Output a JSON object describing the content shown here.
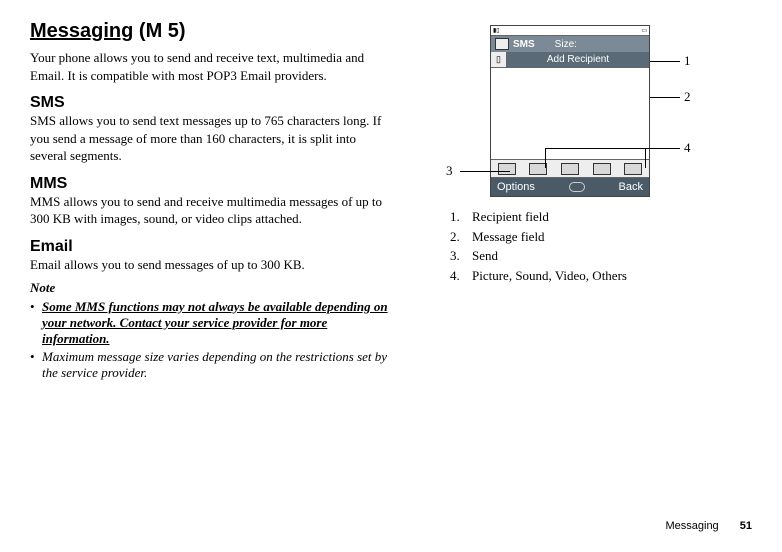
{
  "heading": {
    "title": "Messaging",
    "menu_code": "(M 5)"
  },
  "intro": "Your phone allows you to send and receive text, multimedia and Email. It is compatible with most POP3 Email providers.",
  "sections": {
    "sms": {
      "title": "SMS",
      "body": "SMS allows you to send text messages up to 765 characters long. If you send a message of more than 160 characters, it is split into several segments."
    },
    "mms": {
      "title": "MMS",
      "body": "MMS allows you to send and receive multimedia messages of up to 300 KB with images, sound, or video clips attached."
    },
    "email": {
      "title": "Email",
      "body": "Email allows you to send messages of up to 300 KB."
    }
  },
  "note": {
    "heading": "Note",
    "bullet1": "Some MMS functions may not always be available depending on your network. Contact your service provider for more information.",
    "bullet2": "Maximum message size varies depending on the restrictions set by the service provider."
  },
  "phone": {
    "sms_label": "SMS",
    "size_label": "Size:",
    "add_recipient": "Add Recipient",
    "options": "Options",
    "back": "Back"
  },
  "callouts": {
    "c1": "1",
    "c2": "2",
    "c3": "3",
    "c4": "4"
  },
  "legend": {
    "l1_num": "1.",
    "l1_txt": "Recipient field",
    "l2_num": "2.",
    "l2_txt": "Message field",
    "l3_num": "3.",
    "l3_txt": "Send",
    "l4_num": "4.",
    "l4_txt": "Picture, Sound, Video, Others"
  },
  "footer": {
    "section": "Messaging",
    "page": "51"
  }
}
